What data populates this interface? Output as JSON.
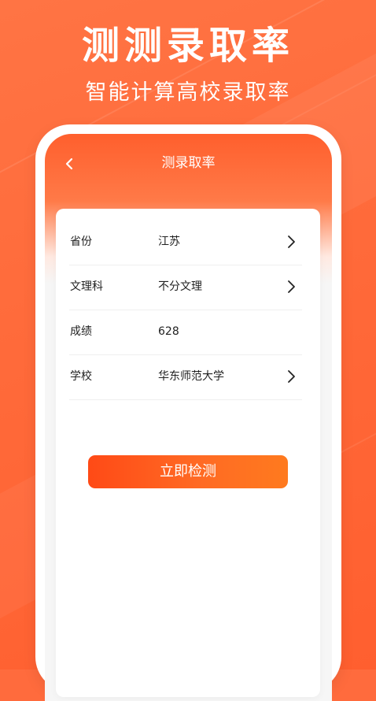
{
  "hero": {
    "title": "测测录取率",
    "subtitle": "智能计算高校录取率"
  },
  "screen": {
    "nav": {
      "title": "测录取率",
      "back_icon": "chevron-left-icon"
    },
    "form": {
      "rows": [
        {
          "label": "省份",
          "value": "江苏",
          "icon": "chevron-right-icon"
        },
        {
          "label": "文理科",
          "value": "不分文理",
          "icon": "chevron-right-icon"
        },
        {
          "label": "成绩",
          "value": "628"
        },
        {
          "label": "学校",
          "value": "华东师范大学",
          "icon": "chevron-right-icon"
        }
      ]
    },
    "button": {
      "label": "立即检测"
    }
  },
  "colors": {
    "background": "#FF6B3D",
    "accent": "#FF5A23",
    "button_start": "#FF4A16",
    "button_end": "#FF7A1E"
  }
}
